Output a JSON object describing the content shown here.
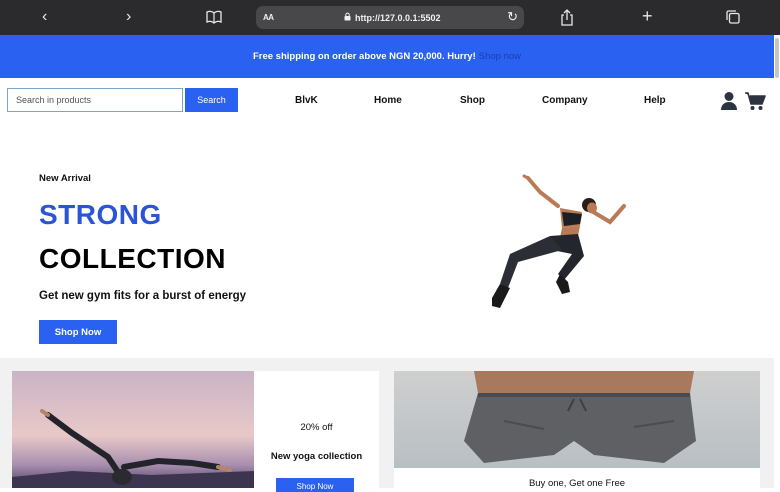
{
  "browser": {
    "text_size_label": "AA",
    "url": "http://127.0.0.1:5502",
    "icons": [
      "back-icon",
      "forward-icon",
      "reader-icon",
      "reload-icon",
      "share-icon",
      "new-tab-icon",
      "tabs-icon"
    ]
  },
  "banner": {
    "text": "Free shipping on order above NGN 20,000. Hurry!",
    "link": "Shop now"
  },
  "header": {
    "search_placeholder": "Search in products",
    "search_button": "Search",
    "nav": [
      "BlvK",
      "Home",
      "Shop",
      "Company",
      "Help"
    ]
  },
  "hero": {
    "subtitle": "New Arrival",
    "title_line1": "STRONG",
    "title_line2": "COLLECTION",
    "description": "Get new gym fits for a burst of energy",
    "button": "Shop Now"
  },
  "cards": [
    {
      "discount": "20% off",
      "title": "New yoga collection",
      "button": "Shop Now"
    },
    {
      "title": "Buy one, Get one Free"
    }
  ],
  "colors": {
    "accent": "#2b61f0",
    "title_blue": "#2b55d6",
    "browser_chrome": "#2b2b2d"
  }
}
